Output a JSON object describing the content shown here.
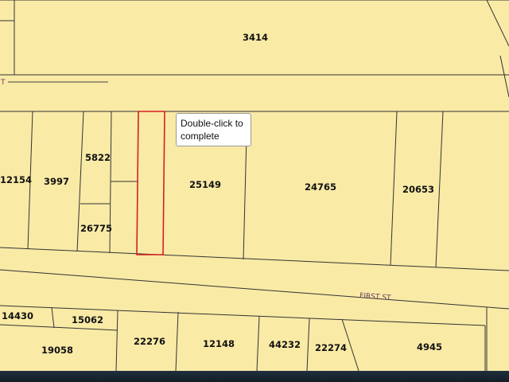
{
  "map": {
    "background_color": "#f9eaa6",
    "line_color": "#333333",
    "selection_color": "#d62020",
    "street_label_color": "#6a3d5a",
    "parcels": [
      {
        "id": "3414",
        "label": "3414"
      },
      {
        "id": "12154",
        "label": "12154"
      },
      {
        "id": "3997",
        "label": "3997"
      },
      {
        "id": "5822",
        "label": "5822"
      },
      {
        "id": "26775",
        "label": "26775"
      },
      {
        "id": "25149",
        "label": "25149"
      },
      {
        "id": "24765",
        "label": "24765"
      },
      {
        "id": "20653",
        "label": "20653"
      },
      {
        "id": "14430",
        "label": "14430"
      },
      {
        "id": "15062",
        "label": "15062"
      },
      {
        "id": "19058",
        "label": "19058"
      },
      {
        "id": "22276",
        "label": "22276"
      },
      {
        "id": "12148",
        "label": "12148"
      },
      {
        "id": "44232",
        "label": "44232"
      },
      {
        "id": "22274",
        "label": "22274"
      },
      {
        "id": "4945",
        "label": "4945"
      }
    ],
    "streets": {
      "first_st": "FIRST ST",
      "top_street_fragment": "T"
    }
  },
  "tooltip": {
    "text": "Double-click to complete"
  }
}
